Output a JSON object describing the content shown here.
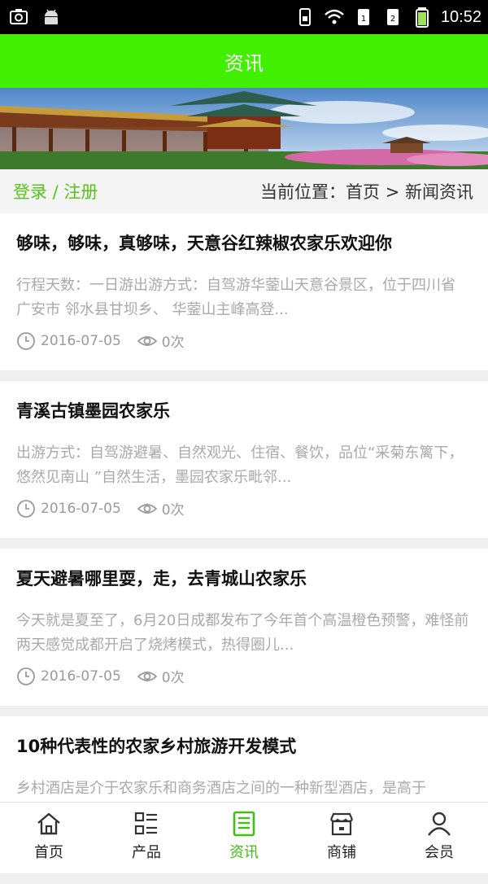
{
  "status_bar": {
    "time": "10:52"
  },
  "header": {
    "title": "资讯"
  },
  "crumb_bar": {
    "login_register": "登录 / 注册",
    "location": "当前位置：首页 > 新闻资讯"
  },
  "articles": [
    {
      "title": "够味，够味，真够味，天意谷红辣椒农家乐欢迎你",
      "desc": "行程天数：一日游出游方式：自驾游华蓥山天意谷景区，位于四川省 广安市 邻水县甘坝乡、 华蓥山主峰高登...",
      "date": "2016-07-05",
      "views": "0次"
    },
    {
      "title": "青溪古镇墨园农家乐",
      "desc": "出游方式：自驾游避暑、自然观光、住宿、餐饮，品位“采菊东篱下，悠然见南山 ”自然生活，墨园农家乐毗邻...",
      "date": "2016-07-05",
      "views": "0次"
    },
    {
      "title": "夏天避暑哪里耍，走，去青城山农家乐",
      "desc": "今天就是夏至了，6月20日成都发布了今年首个高温橙色预警，难怪前两天感觉成都开启了烧烤模式，热得圈儿...",
      "date": "2016-07-05",
      "views": "0次"
    },
    {
      "title": "10种代表性的农家乡村旅游开发模式",
      "desc": "乡村酒店是介于农家乐和商务酒店之间的一种新型酒店，是高于",
      "date": "",
      "views": ""
    }
  ],
  "tabs": [
    {
      "label": "首页",
      "icon": "home-icon"
    },
    {
      "label": "产品",
      "icon": "grid-list-icon"
    },
    {
      "label": "资讯",
      "icon": "news-icon"
    },
    {
      "label": "商铺",
      "icon": "shop-icon"
    },
    {
      "label": "会员",
      "icon": "user-icon"
    }
  ],
  "colors": {
    "accent": "#40f000",
    "active_tab": "#3fbf14",
    "login_text": "#58c41a"
  }
}
